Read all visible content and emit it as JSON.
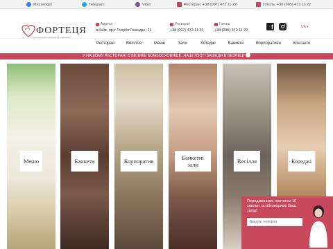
{
  "topbar": {
    "messenger": "Messenger",
    "telegram": "Telegram",
    "viber": "Viber",
    "restaurant_phone": "Ресторан: +38 (097) 472 11 22",
    "hotel_phone": "Готель: +38 (095) 472 11 22"
  },
  "brand": {
    "name": "ФОРТЕЦЯ",
    "subtitle": "ресторанно-готельний комплекс"
  },
  "header": {
    "address_label": "Адреса",
    "address_value": "м.Київ, пр-т Георгія Гонгадзе, 21",
    "restaurant_label": "Ресторан",
    "restaurant_value": "+38 (097) 472 11 22",
    "hotel_label": "Готель",
    "hotel_value": "+38 (095) 472 11 22",
    "language": "UA"
  },
  "nav": {
    "items": [
      "Ресторан",
      "Весілля",
      "Меню",
      "Зали",
      "Котеджі",
      "Банкети",
      "Корпоративи",
      "Контакти"
    ]
  },
  "banner": {
    "text": "У НАШОМУ РЕСТОРАНІ Є ВЕЛИКЕ БОМБОСХОВИЩЕ, НАШІ ГОСТІ ЗАВЖДИ В БЕЗПЕЦІ"
  },
  "categories": {
    "menu": "Меню",
    "banquets": "Банкети",
    "corporate": "Корпоратив",
    "halls": "Банкетні зали",
    "weddings": "Весілля",
    "cottages": "Котеджі"
  },
  "popup": {
    "text": "Передзвонимо протягом 10 хвилин та обговоримо Ваш захід!",
    "input_placeholder": "Введіть телефон"
  },
  "colors": {
    "accent": "#c8485c",
    "messenger": "#3b7ee8",
    "telegram": "#2ea6de",
    "viber": "#7b519d"
  }
}
